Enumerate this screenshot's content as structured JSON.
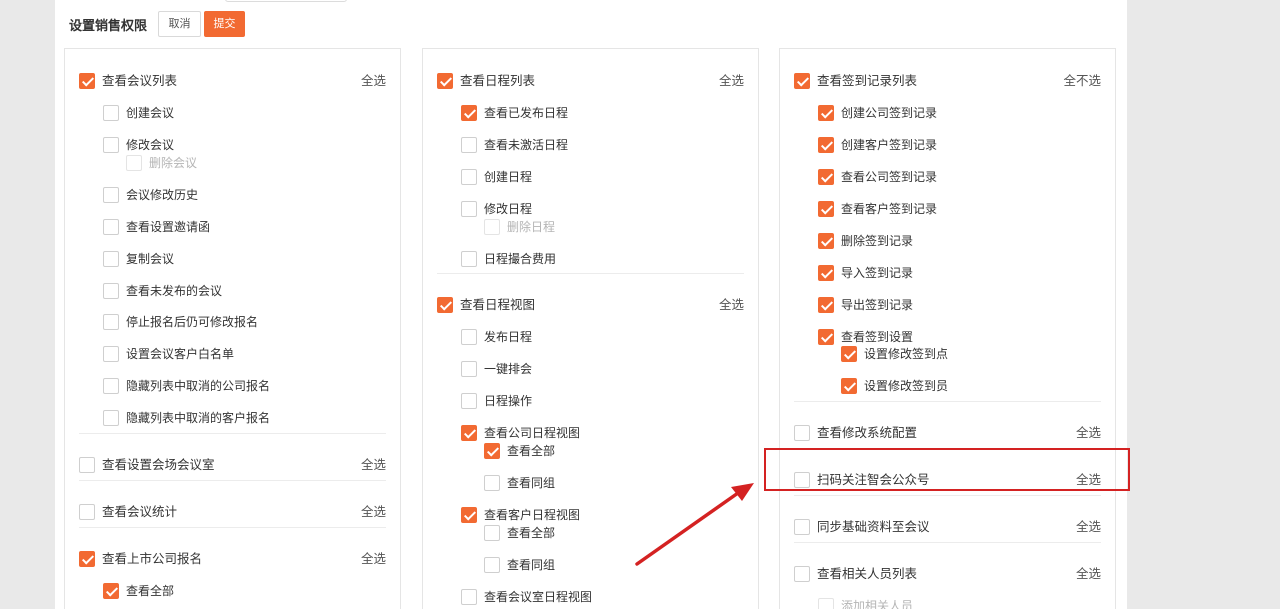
{
  "header": {
    "title": "设置销售权限",
    "cancel_label": "取消",
    "submit_label": "提交"
  },
  "columns": {
    "col1": {
      "groups": [
        {
          "label": "查看会议列表",
          "checked": true,
          "select_label": "全选",
          "items": [
            {
              "label": "创建会议",
              "checked": false
            },
            {
              "label": "修改会议",
              "checked": false
            },
            {
              "label": "删除会议",
              "checked": false,
              "disabled": true
            },
            {
              "label": "会议修改历史",
              "checked": false
            },
            {
              "label": "查看设置邀请函",
              "checked": false
            },
            {
              "label": "复制会议",
              "checked": false
            },
            {
              "label": "查看未发布的会议",
              "checked": false
            },
            {
              "label": "停止报名后仍可修改报名",
              "checked": false
            },
            {
              "label": "设置会议客户白名单",
              "checked": false
            },
            {
              "label": "隐藏列表中取消的公司报名",
              "checked": false
            },
            {
              "label": "隐藏列表中取消的客户报名",
              "checked": false
            }
          ]
        },
        {
          "label": "查看设置会场会议室",
          "checked": false,
          "select_label": "全选",
          "items": []
        },
        {
          "label": "查看会议统计",
          "checked": false,
          "select_label": "全选",
          "items": []
        },
        {
          "label": "查看上市公司报名",
          "checked": true,
          "select_label": "全选",
          "items": [
            {
              "label": "查看全部",
              "checked": true
            },
            {
              "label": "查看同组",
              "checked": false
            }
          ]
        }
      ]
    },
    "col2": {
      "groups": [
        {
          "label": "查看日程列表",
          "checked": true,
          "select_label": "全选",
          "items": [
            {
              "label": "查看已发布日程",
              "checked": true
            },
            {
              "label": "查看未激活日程",
              "checked": false
            },
            {
              "label": "创建日程",
              "checked": false
            },
            {
              "label": "修改日程",
              "checked": false
            },
            {
              "label": "删除日程",
              "checked": false,
              "disabled": true
            },
            {
              "label": "日程撮合费用",
              "checked": false
            }
          ]
        },
        {
          "label": "查看日程视图",
          "checked": true,
          "select_label": "全选",
          "items": [
            {
              "label": "发布日程",
              "checked": false
            },
            {
              "label": "一键排会",
              "checked": false
            },
            {
              "label": "日程操作",
              "checked": false
            },
            {
              "label": "查看公司日程视图",
              "checked": true
            },
            {
              "label": "查看全部",
              "checked": true
            },
            {
              "label": "查看同组",
              "checked": false
            },
            {
              "label": "查看客户日程视图",
              "checked": true
            },
            {
              "label": "查看全部",
              "checked": false
            },
            {
              "label": "查看同组",
              "checked": false
            },
            {
              "label": "查看会议室日程视图",
              "checked": false
            }
          ]
        }
      ]
    },
    "col3": {
      "groups": [
        {
          "label": "查看签到记录列表",
          "checked": true,
          "select_label": "全不选",
          "items": [
            {
              "label": "创建公司签到记录",
              "checked": true
            },
            {
              "label": "创建客户签到记录",
              "checked": true
            },
            {
              "label": "查看公司签到记录",
              "checked": true
            },
            {
              "label": "查看客户签到记录",
              "checked": true
            },
            {
              "label": "删除签到记录",
              "checked": true
            },
            {
              "label": "导入签到记录",
              "checked": true
            },
            {
              "label": "导出签到记录",
              "checked": true
            },
            {
              "label": "查看签到设置",
              "checked": true
            },
            {
              "label": "设置修改签到点",
              "checked": true
            },
            {
              "label": "设置修改签到员",
              "checked": true
            }
          ]
        },
        {
          "label": "查看修改系统配置",
          "checked": false,
          "select_label": "全选",
          "items": []
        },
        {
          "label": "扫码关注智会公众号",
          "checked": false,
          "select_label": "全选",
          "items": []
        },
        {
          "label": "同步基础资料至会议",
          "checked": false,
          "select_label": "全选",
          "items": []
        },
        {
          "label": "查看相关人员列表",
          "checked": false,
          "select_label": "全选",
          "items": [
            {
              "label": "添加相关人员",
              "checked": false,
              "disabled": true
            }
          ]
        }
      ]
    }
  },
  "colors": {
    "accent": "#f26a32",
    "highlight": "#d42222"
  }
}
